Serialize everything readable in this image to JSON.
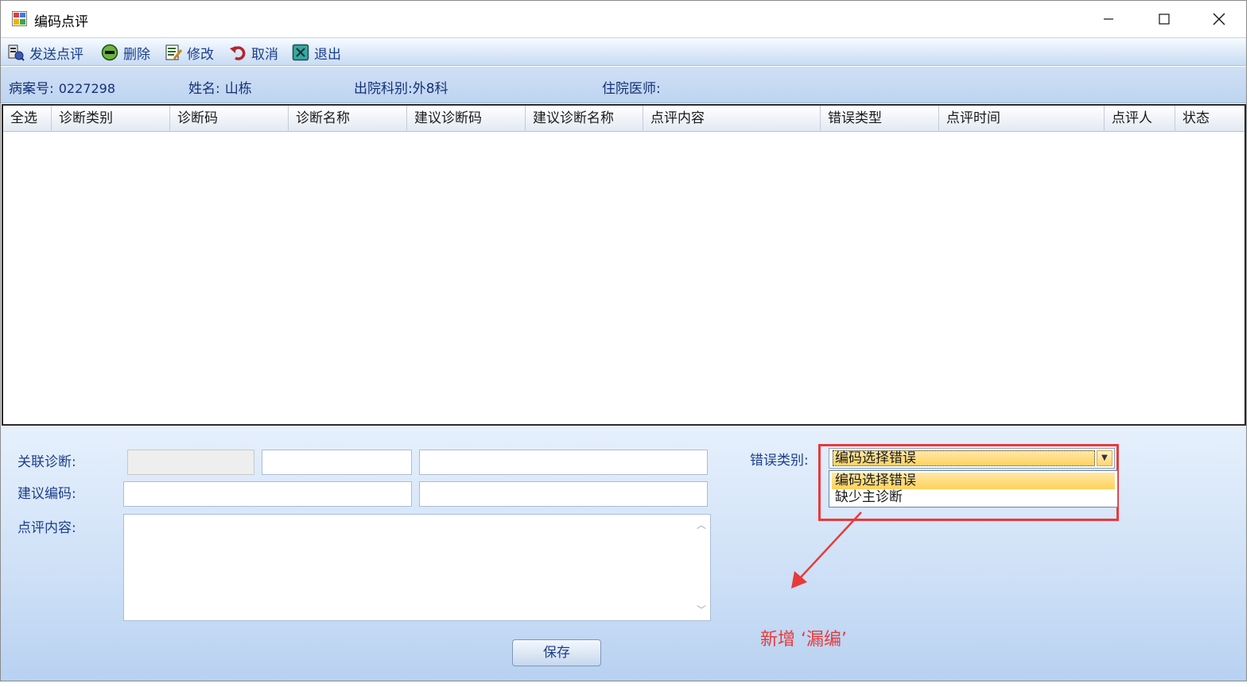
{
  "window": {
    "title": "编码点评",
    "icons": {
      "app": "app-window-icon",
      "minimize": "minimize-icon",
      "maximize": "maximize-icon",
      "close": "close-icon"
    }
  },
  "toolbar": {
    "items": [
      {
        "label": "发送点评",
        "icon": "send-review-icon"
      },
      {
        "label": "删除",
        "icon": "delete-icon"
      },
      {
        "label": "修改",
        "icon": "edit-icon"
      },
      {
        "label": "取消",
        "icon": "undo-icon"
      },
      {
        "label": "退出",
        "icon": "exit-icon"
      }
    ]
  },
  "patient": {
    "record_no_label": "病案号:",
    "record_no": "0227298",
    "name_label": "姓名:",
    "name": "山栋",
    "dept_label": "出院科别:",
    "dept": "外8科",
    "doctor_label": "住院医师:",
    "doctor": ""
  },
  "grid": {
    "columns": [
      "全选",
      "诊断类别",
      "诊断码",
      "诊断名称",
      "建议诊断码",
      "建议诊断名称",
      "点评内容",
      "错误类型",
      "点评时间",
      "点评人",
      "状态"
    ],
    "rows": []
  },
  "form": {
    "related_diag_label": "关联诊断:",
    "suggest_code_label": "建议编码:",
    "review_content_label": "点评内容:",
    "error_type_label": "错误类别:",
    "error_type_selected": "编码选择错误",
    "error_type_options": [
      "编码选择错误",
      "缺少主诊断"
    ],
    "save_label": "保存"
  },
  "annotation": {
    "text": "新增 ‘漏编’",
    "color": "#e83a3a"
  },
  "colors": {
    "accent_text": "#1a3e8c",
    "highlight": "#ffd361",
    "annotation_red": "#e83a3a"
  }
}
